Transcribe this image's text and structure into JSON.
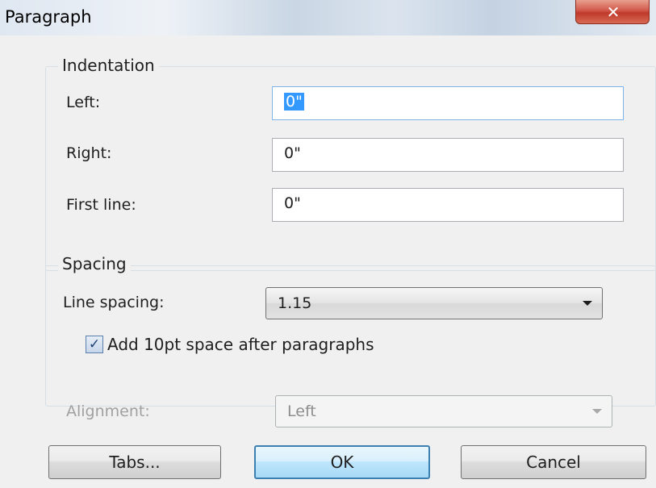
{
  "window": {
    "title": "Paragraph",
    "close_glyph": "✕"
  },
  "indentation": {
    "legend": "Indentation",
    "left_label": "Left:",
    "left_value": "0\"",
    "right_label": "Right:",
    "right_value": "0\"",
    "first_line_label": "First line:",
    "first_line_value": "0\""
  },
  "spacing": {
    "legend": "Spacing",
    "line_spacing_label": "Line spacing:",
    "line_spacing_value": "1.15",
    "add_space_label": "Add 10pt space after paragraphs",
    "add_space_checked": true
  },
  "alignment": {
    "label": "Alignment:",
    "value": "Left",
    "enabled": false
  },
  "buttons": {
    "tabs": "Tabs...",
    "ok": "OK",
    "cancel": "Cancel"
  },
  "icons": {
    "close": "close-icon",
    "dropdown": "chevron-down-icon",
    "checkmark": "checkmark-icon"
  },
  "colors": {
    "selection": "#3399ff",
    "close_button": "#c0392b",
    "default_button_border": "#3c7fb1"
  }
}
